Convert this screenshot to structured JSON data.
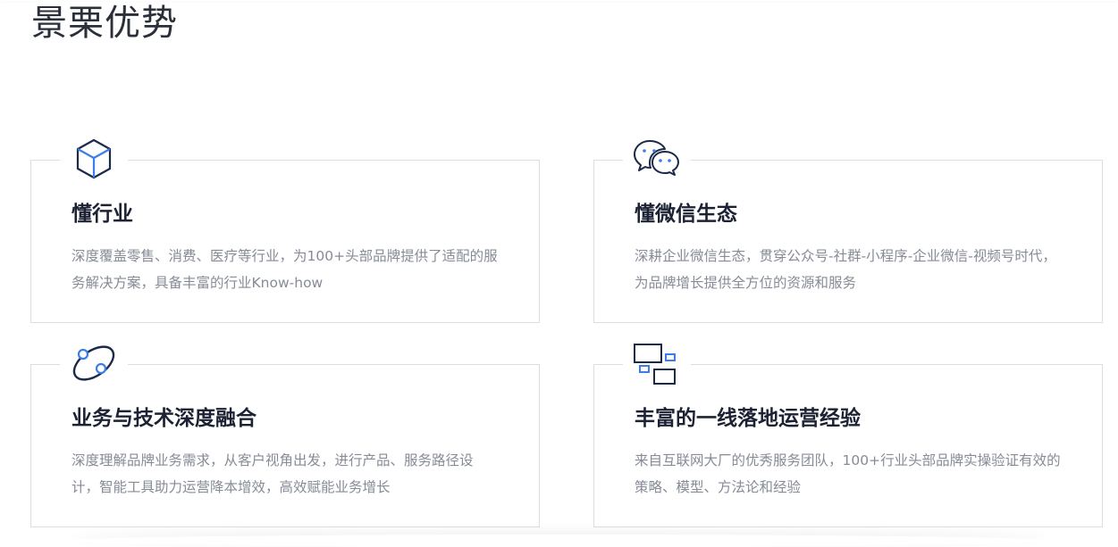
{
  "page": {
    "title": "景栗优势"
  },
  "colors": {
    "icon_dark": "#1c2a4a",
    "icon_accent": "#3b7de9",
    "border": "#dcdde2",
    "desc_text": "#868b96"
  },
  "cards": [
    {
      "icon": "cube-icon",
      "title": "懂行业",
      "desc": "深度覆盖零售、消费、医疗等行业，为100+头部品牌提供了适配的服务解决方案，具备丰富的行业Know-how"
    },
    {
      "icon": "wechat-icon",
      "title": "懂微信生态",
      "desc": "深耕企业微信生态，贯穿公众号-社群-小程序-企业微信-视频号时代，为品牌增长提供全方位的资源和服务"
    },
    {
      "icon": "orbit-link-icon",
      "title": "业务与技术深度融合",
      "desc": "深度理解品牌业务需求，从客户视角出发，进行产品、服务路径设计，智能工具助力运营降本增效，高效赋能业务增长"
    },
    {
      "icon": "layout-blocks-icon",
      "title": "丰富的一线落地运营经验",
      "desc": "来自互联网大厂的优秀服务团队，100+行业头部品牌实操验证有效的策略、模型、方法论和经验"
    }
  ]
}
